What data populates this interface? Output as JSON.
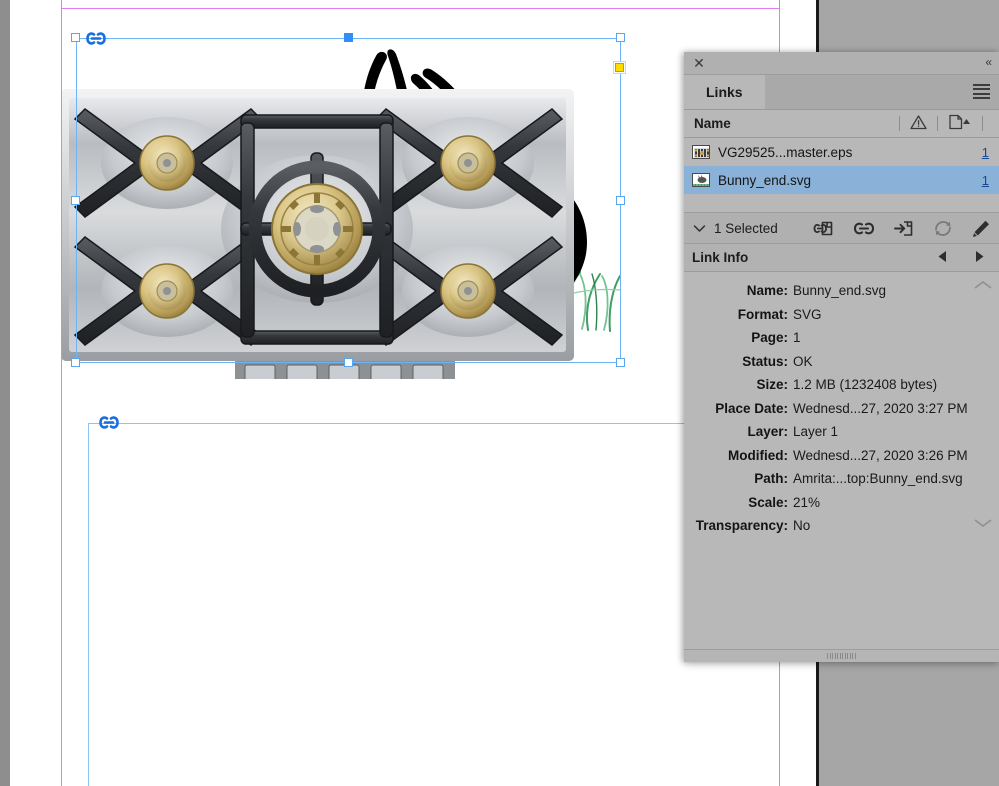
{
  "app": {
    "document_background": "#a6a6a6",
    "page_background": "#ffffff",
    "margin_guide_color": "#e07bf0",
    "selection_color": "#56a6f2"
  },
  "canvas": {
    "objects": [
      {
        "name": "Bunny_end.svg",
        "selected": true,
        "link_badge": "link-badge-icon",
        "description": "Line-art rabbit with spots sitting on green grass"
      },
      {
        "name": "VG29525...master.eps",
        "selected": false,
        "link_badge": "link-badge-icon",
        "description": "Stainless steel gas cooktop with brass burners"
      }
    ]
  },
  "panel": {
    "close_label": "✕",
    "collapse_label": "«",
    "tab_label": "Links",
    "menu_icon": "hamburger-menu-icon",
    "columns": {
      "name": "Name",
      "status_icon": "warning-triangle-icon",
      "page_icon": "page-sort-icon"
    },
    "links": [
      {
        "thumb": "eps-thumbnail",
        "name": "VG29525...master.eps",
        "page": "1",
        "selected": false
      },
      {
        "thumb": "svg-thumbnail",
        "name": "Bunny_end.svg",
        "page": "1",
        "selected": true
      }
    ],
    "selection_bar": {
      "caret_icon": "chevron-down-icon",
      "count_label": "1 Selected",
      "tools": [
        {
          "icon": "relink-icon",
          "enabled": true
        },
        {
          "icon": "go-to-link-icon",
          "enabled": true
        },
        {
          "icon": "relink-to-file-icon",
          "enabled": true
        },
        {
          "icon": "update-link-icon",
          "enabled": false
        },
        {
          "icon": "edit-original-icon",
          "enabled": true
        }
      ]
    },
    "link_info": {
      "title": "Link Info",
      "prev_icon": "nav-prev-icon",
      "next_icon": "nav-next-icon",
      "rows": [
        {
          "label": "Name:",
          "value": "Bunny_end.svg"
        },
        {
          "label": "Format:",
          "value": "SVG"
        },
        {
          "label": "Page:",
          "value": "1"
        },
        {
          "label": "Status:",
          "value": "OK"
        },
        {
          "label": "Size:",
          "value": "1.2 MB (1232408 bytes)"
        },
        {
          "label": "Place Date:",
          "value": "Wednesd...27, 2020 3:27 PM"
        },
        {
          "label": "Layer:",
          "value": "Layer 1"
        },
        {
          "label": "Modified:",
          "value": "Wednesd...27, 2020 3:26 PM"
        },
        {
          "label": "Path:",
          "value": "Amrita:...top:Bunny_end.svg"
        },
        {
          "label": "Scale:",
          "value": "21%"
        },
        {
          "label": "Transparency:",
          "value": "No"
        }
      ],
      "scroll_up_icon": "scroll-up-chevron-icon",
      "scroll_down_icon": "scroll-down-chevron-icon"
    },
    "resize_grip": "resize-grip-icon"
  }
}
